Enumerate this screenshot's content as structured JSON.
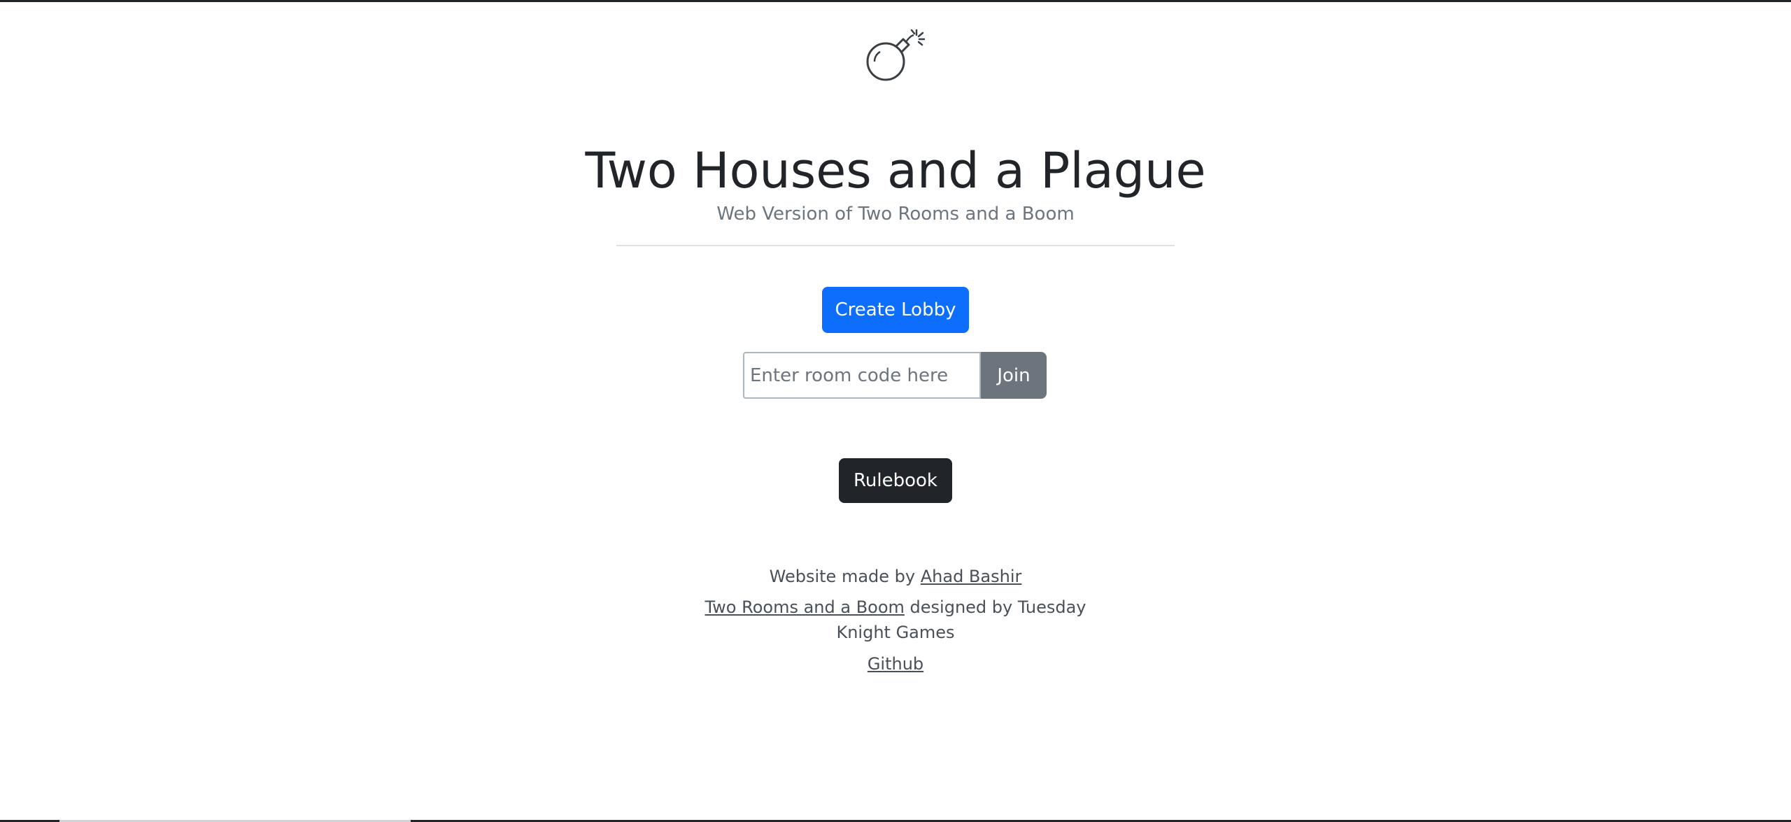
{
  "header": {
    "logo_icon": "bomb-icon"
  },
  "main": {
    "title": "Two Houses and a Plague",
    "subtitle": "Web Version of Two Rooms and a Boom",
    "create_lobby_label": "Create Lobby",
    "room_code_placeholder": "Enter room code here",
    "room_code_value": "",
    "join_label": "Join",
    "rulebook_label": "Rulebook"
  },
  "footer": {
    "made_by_prefix": "Website made by ",
    "author_link": "Ahad Bashir",
    "game_link": "Two Rooms and a Boom",
    "designed_by_text": " designed by Tuesday Knight Games",
    "github_link": "Github"
  },
  "colors": {
    "primary": "#0d6efd",
    "secondary": "#6c757d",
    "dark": "#212529"
  }
}
